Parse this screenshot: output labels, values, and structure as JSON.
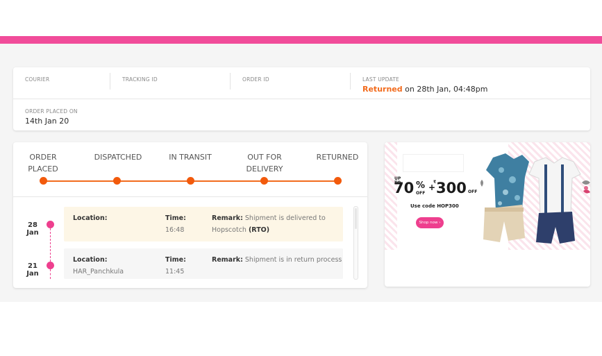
{
  "order_info": {
    "courier_label": "COURIER",
    "tracking_label": "TRACKING ID",
    "order_id_label": "ORDER ID",
    "last_update_label": "LAST UPDATE",
    "last_update_status": "Returned",
    "last_update_rest": " on 28th Jan, 04:48pm",
    "placed_label": "ORDER PLACED ON",
    "placed_value": "14th Jan 20"
  },
  "stages": [
    {
      "line1": "ORDER",
      "line2": "PLACED"
    },
    {
      "line1": "DISPATCHED",
      "line2": ""
    },
    {
      "line1": "IN TRANSIT",
      "line2": ""
    },
    {
      "line1": "OUT FOR",
      "line2": "DELIVERY"
    },
    {
      "line1": "RETURNED",
      "line2": ""
    }
  ],
  "events": [
    {
      "day": "28",
      "month": "Jan",
      "location_label": "Location:",
      "location": "",
      "time_label": "Time:",
      "time": "16:48",
      "remark_label": "Remark:",
      "remark1": " Shipment is delivered to",
      "remark2a": "Hopscotch ",
      "remark2b": "(RTO)"
    },
    {
      "day": "21",
      "month": "Jan",
      "location_label": "Location:",
      "location": "HAR_Panchkula",
      "time_label": "Time:",
      "time": "11:45",
      "remark_label": "Remark:",
      "remark1": " Shipment is in return process"
    }
  ],
  "promo": {
    "upto_1": "UP",
    "upto_2": "TO",
    "discount": "70",
    "percent": "%",
    "off": "OFF",
    "plus": "+",
    "rupee": "₹",
    "amount": "300",
    "code_text": "Use code HOP300",
    "shop_button": "Shop now ›"
  },
  "colors": {
    "brand_pink": "#f14c9a",
    "progress_orange": "#f26b1d",
    "timeline_pink": "#ee3f8e"
  }
}
